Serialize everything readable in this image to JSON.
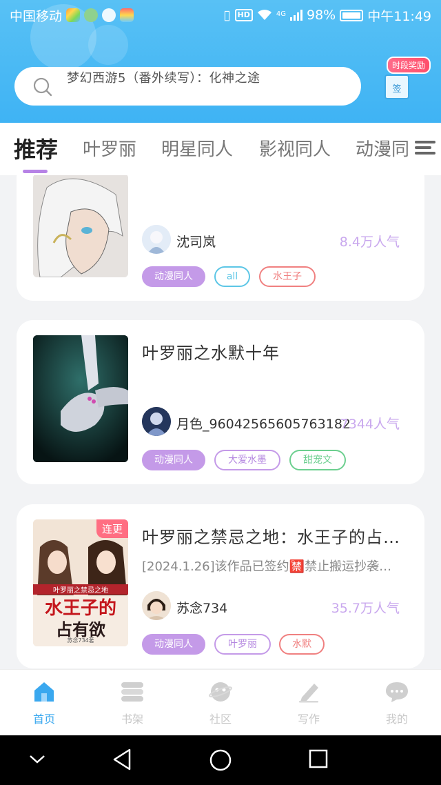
{
  "status_bar": {
    "carrier": "中国移动",
    "battery": "98%",
    "time": "中午11:49",
    "network": "4G"
  },
  "search": {
    "placeholder": "梦幻西游5（番外续写）：化神之途"
  },
  "reward": {
    "badge": "时段奖励",
    "gift_label": "签"
  },
  "tabs": [
    {
      "label": "推荐",
      "active": true
    },
    {
      "label": "叶罗丽"
    },
    {
      "label": "明星同人"
    },
    {
      "label": "影视同人"
    },
    {
      "label": "动漫同"
    }
  ],
  "cards": [
    {
      "author": "沈司岚",
      "popularity": "8.4万人气",
      "tags": [
        "动漫同人",
        "all",
        "水王子"
      ]
    },
    {
      "title": "叶罗丽之水默十年",
      "author": "月色_96042565605763182",
      "popularity": "7344人气",
      "tags": [
        "动漫同人",
        "大爱水墨",
        "甜宠文"
      ]
    },
    {
      "title": "叶罗丽之禁忌之地：水王子的占…",
      "desc": "[2024.1.26]该作品已签约🈲禁止搬运抄袭…",
      "author": "苏念734",
      "popularity": "35.7万人气",
      "badge": "连更",
      "cover_text": [
        "叶罗丽之禁忌之地",
        "水王子的",
        "占有欲",
        "苏念734著"
      ],
      "tags": [
        "动漫同人",
        "叶罗丽",
        "水默"
      ]
    }
  ],
  "bottom_nav": [
    {
      "label": "首页",
      "icon": "home-icon",
      "active": true
    },
    {
      "label": "书架",
      "icon": "bookshelf-icon"
    },
    {
      "label": "社区",
      "icon": "community-icon"
    },
    {
      "label": "写作",
      "icon": "write-icon"
    },
    {
      "label": "我的",
      "icon": "profile-icon"
    }
  ],
  "colors": {
    "header": "#3fb3f4",
    "accent_purple": "#c49ae8",
    "popularity": "#c9a8ee",
    "tag_cyan": "#5cc6e6",
    "tag_red": "#f08080",
    "tag_green": "#6ccf8f",
    "nav_active": "#3aa8ef"
  }
}
